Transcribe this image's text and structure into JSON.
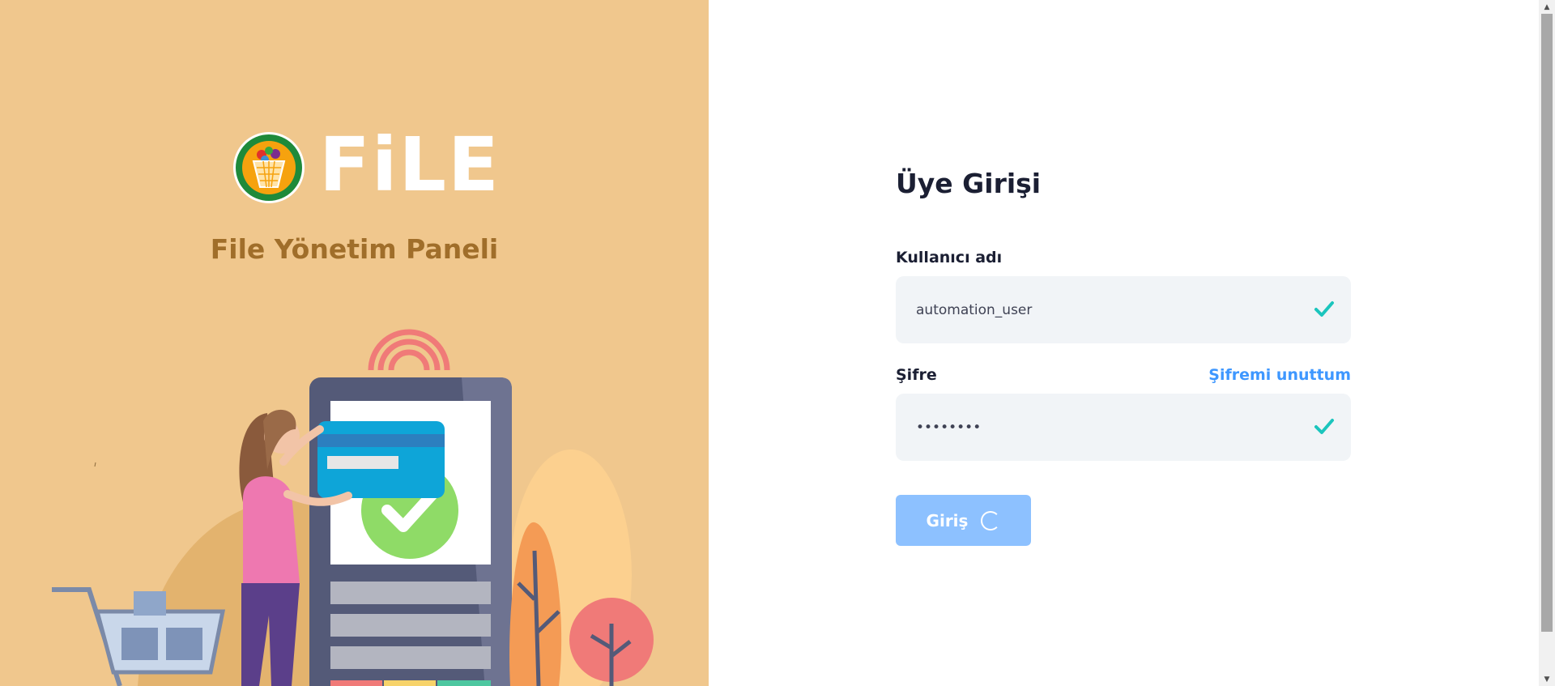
{
  "brand": {
    "logo_text": "FiLE",
    "panel_title": "File Yönetim Paneli"
  },
  "login": {
    "title": "Üye Girişi",
    "username_label": "Kullanıcı adı",
    "username_value": "automation_user",
    "password_label": "Şifre",
    "forgot_link": "Şifremi unuttum",
    "password_value": "••••••••",
    "submit_label": "Giriş",
    "loading": true
  },
  "icons": {
    "valid": "check-icon",
    "loading": "spinner-icon"
  },
  "colors": {
    "left_panel_bg": "#f0c78d",
    "panel_title": "#a06e2a",
    "accent_link": "#3e97ff",
    "button_bg": "#8dc1ff",
    "valid_check": "#1bc5bd",
    "input_bg": "#f1f4f7"
  }
}
